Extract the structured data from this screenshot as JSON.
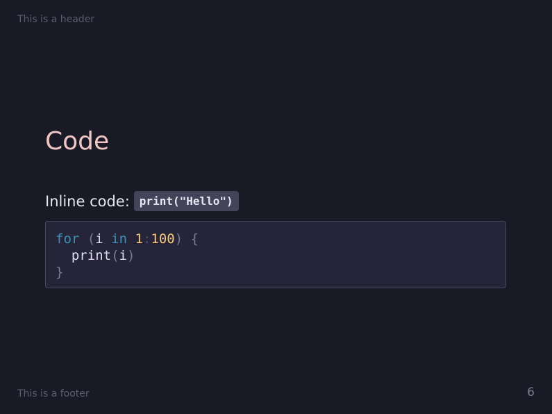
{
  "slide": {
    "header": "This is a header",
    "footer": "This is a footer",
    "page_number": "6",
    "title": "Code",
    "inline": {
      "label": "Inline code:",
      "code": "print(\"Hello\")"
    },
    "code_block": {
      "line1": {
        "kw_for": "for",
        "open_paren": "(",
        "var_i": "i",
        "kw_in": "in",
        "num_start": "1",
        "colon": ":",
        "num_end": "100",
        "close_paren": ")",
        "open_brace": "{"
      },
      "line2": {
        "fn": "print",
        "open_paren": "(",
        "arg": "i",
        "close_paren": ")"
      },
      "line3": {
        "close_brace": "}"
      }
    },
    "colors": {
      "background": "#1a1a27",
      "title": "#f0c6c3",
      "keyword": "#3d91b6",
      "number": "#f9c97a",
      "code_bg": "#262438"
    }
  }
}
